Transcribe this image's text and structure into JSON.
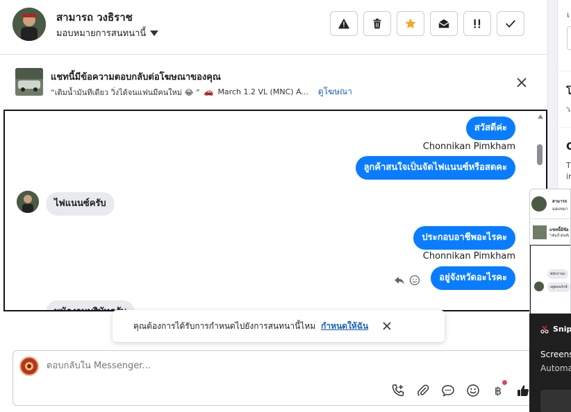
{
  "header": {
    "name": "สามารถ วงธิราช",
    "assign_label": "มอบหมายการสนทนานี้",
    "actions": [
      "warning-icon",
      "trash-icon",
      "star-icon",
      "envelope-open-icon",
      "double-exclamation-icon",
      "check-icon"
    ],
    "colors": {
      "star": "#f5a623"
    }
  },
  "ad": {
    "title": "แชทนี้มีข้อความตอบกลับต่อโฆษณาของคุณ",
    "quote": "“เติมน้ำมันทีเดียว วิ่งได้จนแฟนมีคนใหม่ 😂 ”",
    "model": "March 1.2 VL (MNC) A...",
    "link": "ดูโฆษณา"
  },
  "messages": [
    {
      "dir": "out",
      "text": "สวัสดีค่ะ"
    },
    {
      "dir": "sender",
      "text": "Chonnikan Pimkham"
    },
    {
      "dir": "out",
      "text": "ลูกค้าสนใจเป็นจัดไฟแนนซ์หรือสดคะ"
    },
    {
      "dir": "in",
      "text": "ไฟแนนซ์ครับ"
    },
    {
      "dir": "out",
      "text": "ประกอบอาชีพอะไรคะ"
    },
    {
      "dir": "sender",
      "text": "Chonnikan Pimkham"
    },
    {
      "dir": "out",
      "text": "อยู่จังหวัดอะไรคะ"
    },
    {
      "dir": "in",
      "text": "พนักงานบริษัทครับ"
    }
  ],
  "toast": {
    "text": "คุณต้องการได้รับการกำหนดไปยังการสนทนานี้ไหม",
    "link": "กำหนดให้ฉัน"
  },
  "reply": {
    "placeholder": "ตอบกลับใน Messenger...",
    "tools": [
      "phone-plus-icon",
      "paperclip-icon",
      "chat-bubble-icon",
      "smiley-icon",
      "baht-icon",
      "thumbs-up-icon"
    ],
    "baht": "฿"
  },
  "side": {
    "line1": "เ",
    "line2": "โ",
    "line3": "'เ",
    "line4": "C",
    "line5": "T",
    "line6": "ir"
  },
  "mini": {
    "name": "สามารถ",
    "assign": "มอบหมา",
    "ad_title": "แชทนี้มีข้อ",
    "ad_quote": "\"เติมน้ำมันทีเ",
    "msg1": "พนักงานบ",
    "msg2": "อยู่ดอนรักษ์"
  },
  "snip": {
    "app": "Snip",
    "line1": "Screens",
    "line2": "Automa"
  }
}
